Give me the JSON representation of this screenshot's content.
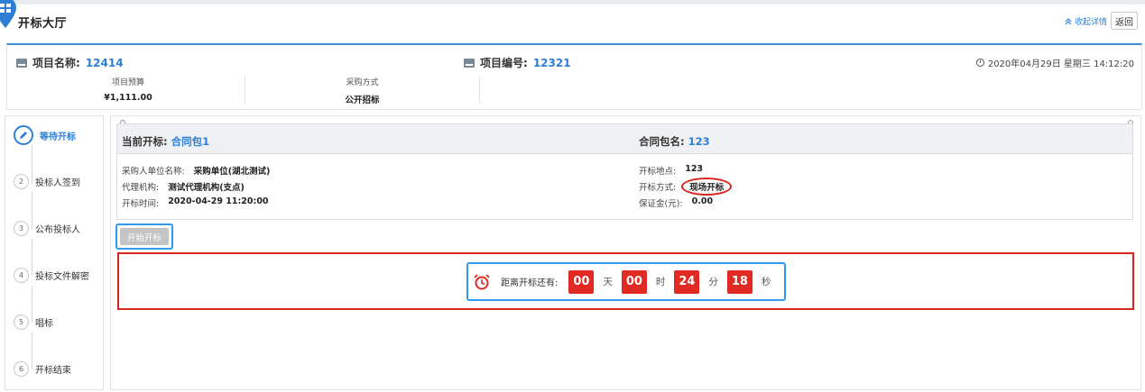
{
  "header": {
    "title": "开标大厅",
    "collapse_label": "收起详情",
    "back_label": "返回"
  },
  "project": {
    "name_label": "项目名称:",
    "name_value": "12414",
    "code_label": "项目编号:",
    "code_value": "12321",
    "datetime": "2020年04月29日 星期三 14:12:20",
    "budget_label": "项目预算",
    "budget_value": "¥1,111.00",
    "method_label": "采购方式",
    "method_value": "公开招标"
  },
  "steps": [
    {
      "num": "",
      "label": "等待开标",
      "active": true
    },
    {
      "num": "2",
      "label": "投标人签到"
    },
    {
      "num": "3",
      "label": "公布投标人"
    },
    {
      "num": "4",
      "label": "投标文件解密"
    },
    {
      "num": "5",
      "label": "唱标"
    },
    {
      "num": "6",
      "label": "开标结束"
    }
  ],
  "contract": {
    "current_label": "当前开标:",
    "current_value": "合同包1",
    "pkg_label": "合同包名:",
    "pkg_value": "123",
    "buyer_label": "采购人单位名称:",
    "buyer_value": "采购单位(湖北测试)",
    "agency_label": "代理机构:",
    "agency_value": "测试代理机构(支点)",
    "time_label": "开标时间:",
    "time_value": "2020-04-29 11:20:00",
    "place_label": "开标地点:",
    "place_value": "123",
    "mode_label": "开标方式:",
    "mode_value": "现场开标",
    "deposit_label": "保证金(元):",
    "deposit_value": "0.00"
  },
  "start_button": "开始开标",
  "countdown": {
    "label": "距离开标还有:",
    "days": "00",
    "days_unit": "天",
    "hours": "00",
    "hours_unit": "时",
    "minutes": "24",
    "minutes_unit": "分",
    "seconds": "18",
    "seconds_unit": "秒"
  },
  "colors": {
    "accent": "#2d7fd6",
    "highlight_red": "#d7261c",
    "highlight_blue": "#2e9bf0",
    "digit_bg": "#e02a23"
  }
}
